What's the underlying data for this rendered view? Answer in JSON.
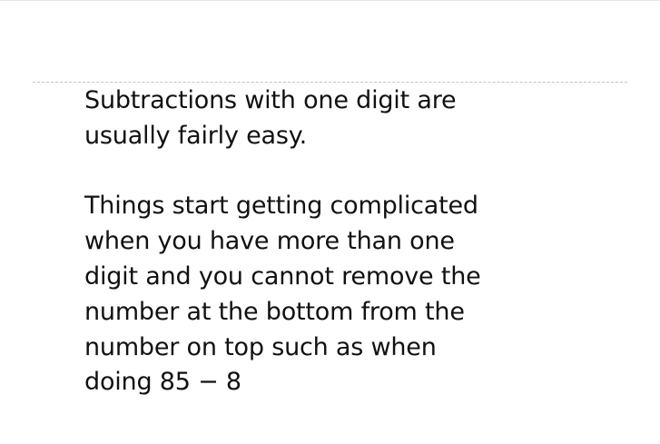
{
  "slide": {
    "paragraphs": [
      {
        "lines": [
          "Subtractions with one digit are",
          "usually fairly easy."
        ]
      },
      {
        "lines": [
          "Things start getting complicated",
          "when you have more than one",
          "digit and you cannot remove the",
          "number at the bottom from the",
          "number on top such as when",
          "doing 85 − 8"
        ]
      }
    ]
  }
}
